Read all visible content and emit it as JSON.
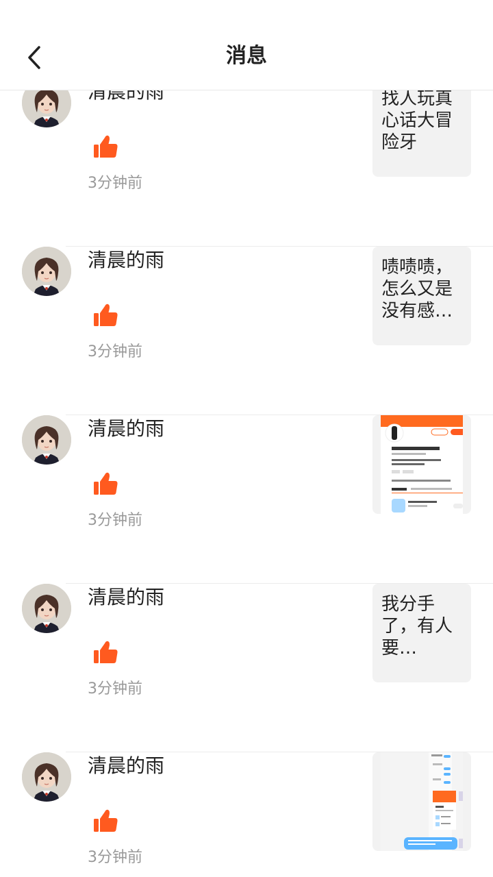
{
  "header": {
    "title": "消息",
    "back_icon": "chevron-left-icon"
  },
  "colors": {
    "like": "#ff5a1f",
    "time": "#999999",
    "preview_bg": "#f2f2f2"
  },
  "items": [
    {
      "name": "清晨的雨",
      "time": "3分钟前",
      "preview_type": "text",
      "preview_text": "找人玩真心话大冒险牙"
    },
    {
      "name": "清晨的雨",
      "time": "3分钟前",
      "preview_type": "text",
      "preview_text": "啧啧啧，怎么又是没有感…"
    },
    {
      "name": "清晨的雨",
      "time": "3分钟前",
      "preview_type": "image",
      "preview_text": ""
    },
    {
      "name": "清晨的雨",
      "time": "3分钟前",
      "preview_type": "text",
      "preview_text": "我分手了，有人要…"
    },
    {
      "name": "清晨的雨",
      "time": "3分钟前",
      "preview_type": "image",
      "preview_text": ""
    }
  ]
}
